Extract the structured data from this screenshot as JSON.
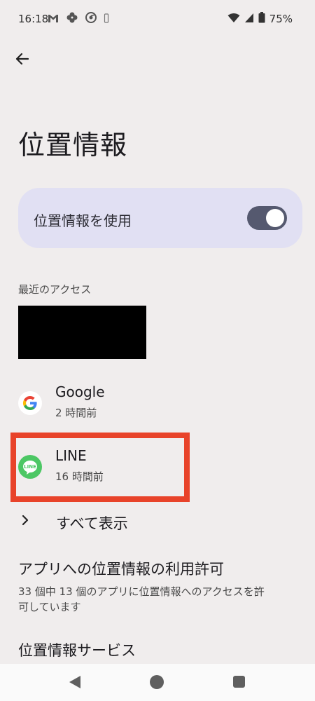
{
  "status_bar": {
    "time": "16:18",
    "battery": "75%",
    "left_icons": [
      "gmail-icon",
      "pinwheel-icon",
      "chrome-icon",
      "vibrate-icon"
    ],
    "right_icons": [
      "wifi-icon",
      "signal-icon",
      "battery-icon"
    ]
  },
  "header": {
    "title": "位置情報"
  },
  "location_toggle": {
    "label": "位置情報を使用",
    "enabled": true
  },
  "recent_access": {
    "section_label": "最近のアクセス",
    "apps": [
      {
        "name": "Google",
        "time": "2 時間前",
        "icon": "google-icon"
      },
      {
        "name": "LINE",
        "time": "16 時間前",
        "icon": "line-icon"
      }
    ],
    "show_all_label": "すべて表示"
  },
  "permissions": {
    "title": "アプリへの位置情報の利用許可",
    "subtitle": "33 個中 13 個のアプリに位置情報へのアクセスを許可しています"
  },
  "services": {
    "title": "位置情報サービス"
  },
  "colors": {
    "background": "#f0eded",
    "card": "#e1e0f3",
    "toggle_track": "#55596f",
    "highlight": "#e8432a",
    "line_green": "#4cc764"
  }
}
